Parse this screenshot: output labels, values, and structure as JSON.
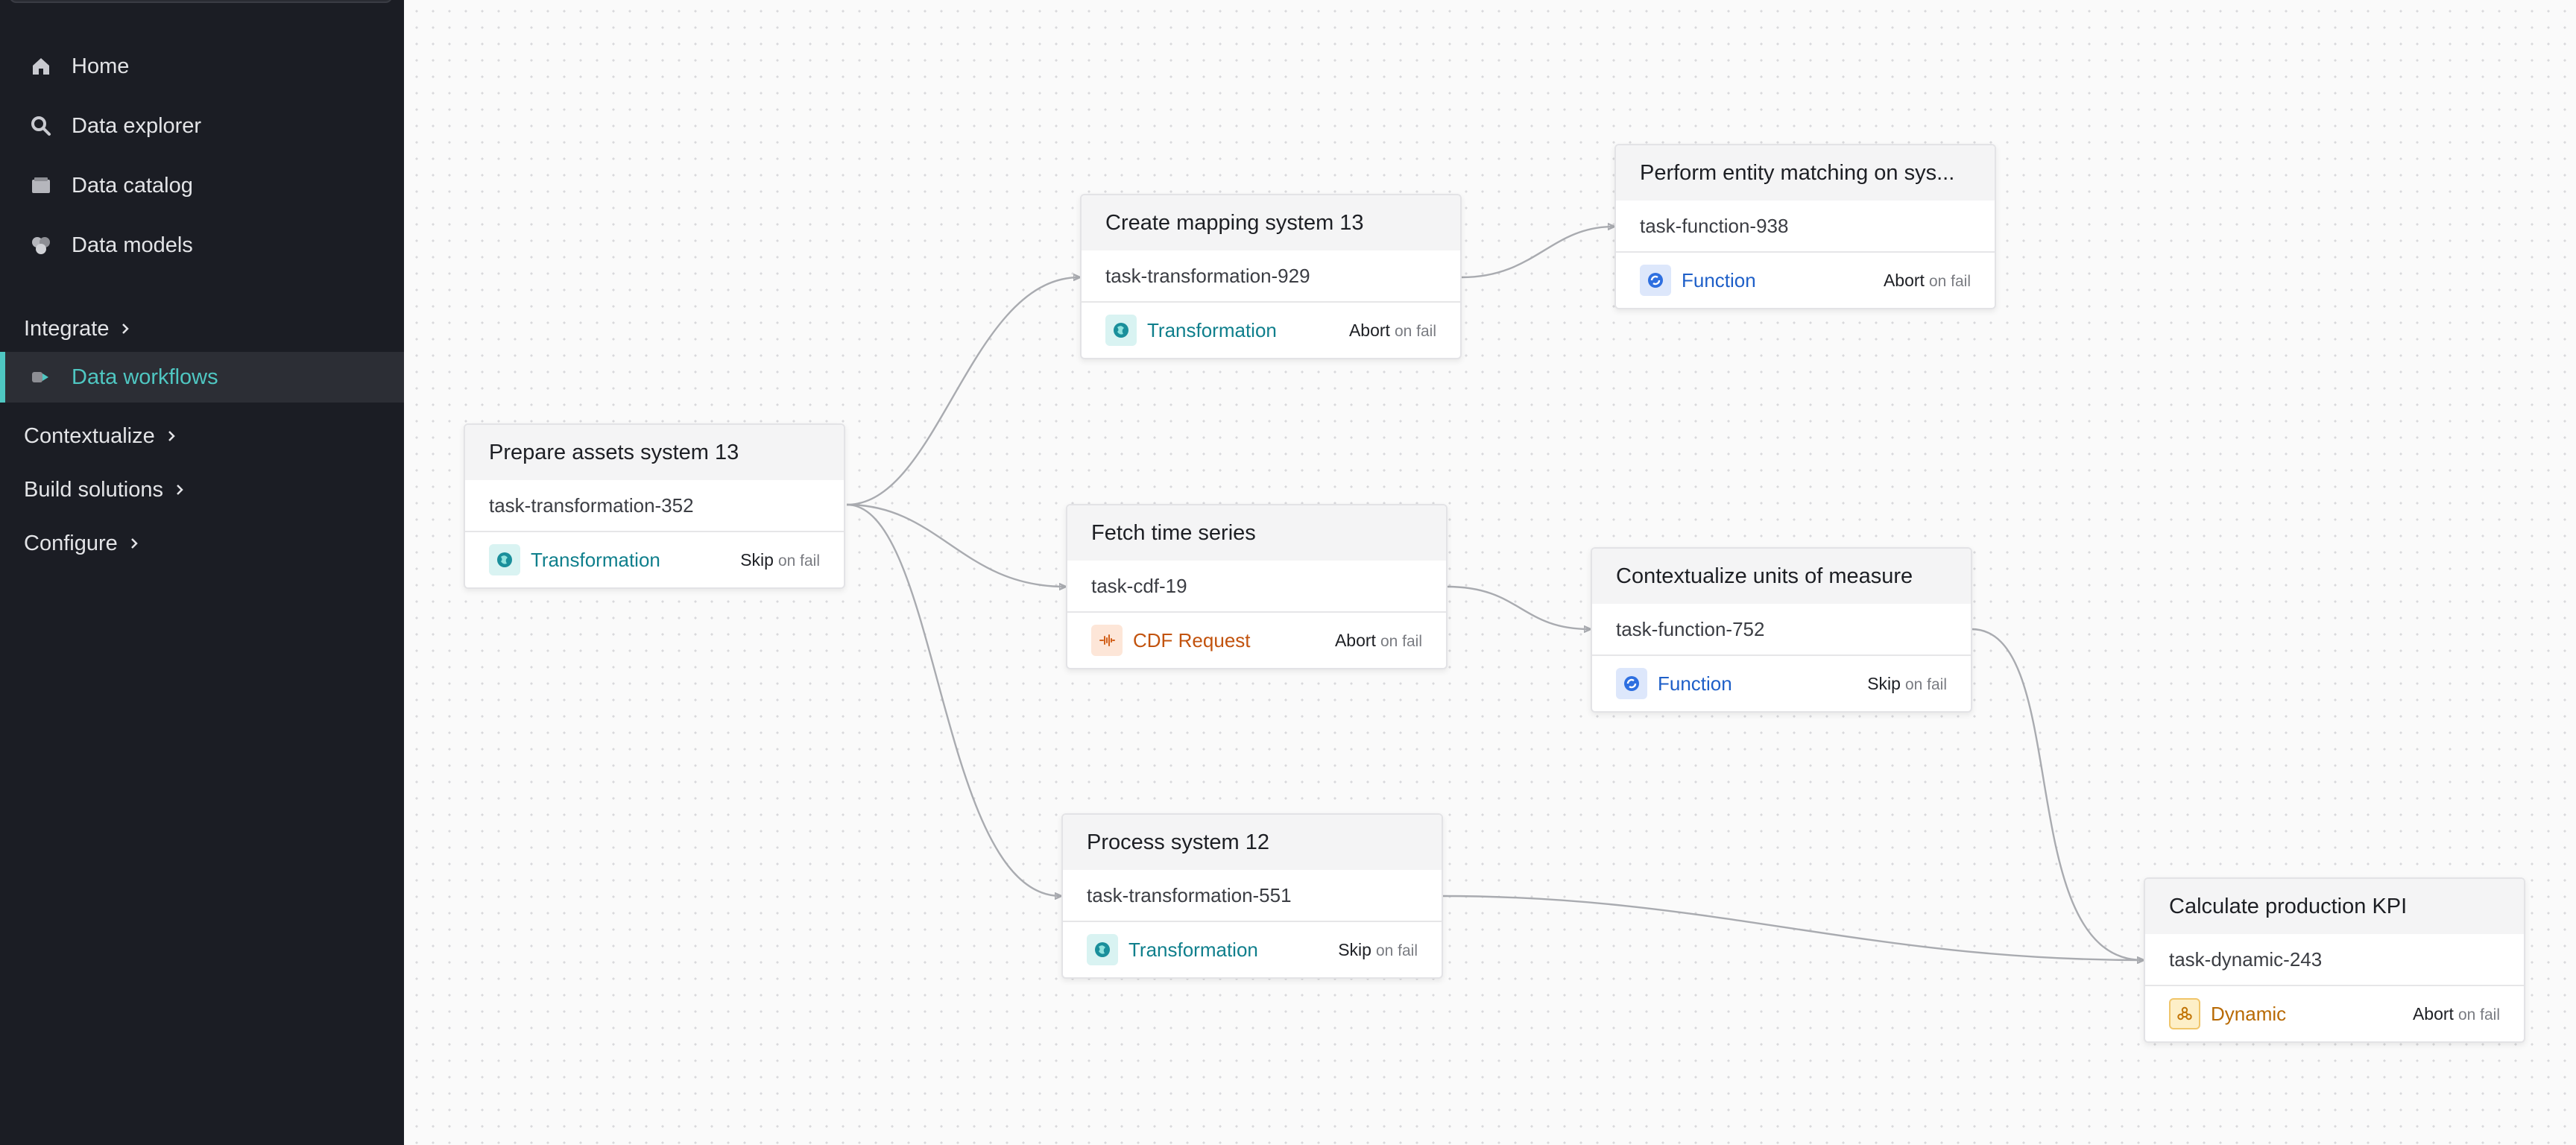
{
  "sidebar": {
    "items": [
      {
        "label": "Home",
        "icon": "home-icon"
      },
      {
        "label": "Data explorer",
        "icon": "search-icon"
      },
      {
        "label": "Data catalog",
        "icon": "catalog-icon"
      },
      {
        "label": "Data models",
        "icon": "data-models-icon"
      }
    ],
    "groups": {
      "integrate": "Integrate",
      "contextualize": "Contextualize",
      "build_solutions": "Build solutions",
      "configure": "Configure"
    },
    "active_item": {
      "label": "Data workflows",
      "icon": "workflow-icon"
    },
    "accent_color": "#4fc7c2"
  },
  "workflow": {
    "on_fail_suffix": "on fail",
    "nodes": {
      "prepare": {
        "title": "Prepare assets system 13",
        "task_id": "task-transformation-352",
        "type": "Transformation",
        "on_fail": "Skip"
      },
      "mapping": {
        "title": "Create mapping system 13",
        "task_id": "task-transformation-929",
        "type": "Transformation",
        "on_fail": "Abort"
      },
      "entity": {
        "title": "Perform entity matching on sys...",
        "task_id": "task-function-938",
        "type": "Function",
        "on_fail": "Abort"
      },
      "fetch": {
        "title": "Fetch time series",
        "task_id": "task-cdf-19",
        "type": "CDF Request",
        "on_fail": "Abort"
      },
      "units": {
        "title": "Contextualize units of measure",
        "task_id": "task-function-752",
        "type": "Function",
        "on_fail": "Skip"
      },
      "process": {
        "title": "Process system 12",
        "task_id": "task-transformation-551",
        "type": "Transformation",
        "on_fail": "Skip"
      },
      "kpi": {
        "title": "Calculate production KPI",
        "task_id": "task-dynamic-243",
        "type": "Dynamic",
        "on_fail": "Abort"
      }
    },
    "edges": [
      {
        "from": "prepare",
        "to": "mapping"
      },
      {
        "from": "prepare",
        "to": "fetch"
      },
      {
        "from": "prepare",
        "to": "process"
      },
      {
        "from": "mapping",
        "to": "entity"
      },
      {
        "from": "fetch",
        "to": "units"
      },
      {
        "from": "units",
        "to": "kpi"
      },
      {
        "from": "process",
        "to": "kpi"
      }
    ]
  }
}
